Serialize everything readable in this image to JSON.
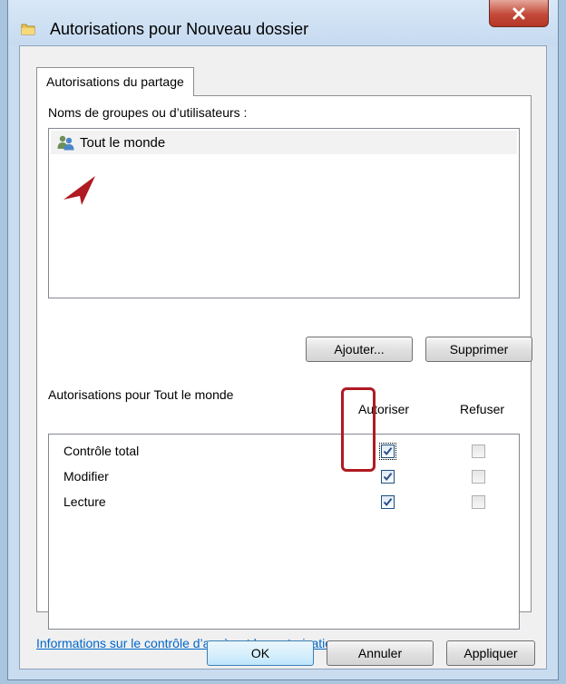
{
  "window": {
    "title": "Autorisations pour Nouveau dossier",
    "close_label": "X"
  },
  "tab": {
    "label": "Autorisations du partage"
  },
  "groups": {
    "label": "Noms de groupes ou d’utilisateurs :",
    "items": [
      {
        "label": "Tout le monde",
        "icon": "users-icon",
        "selected": true
      }
    ]
  },
  "group_buttons": {
    "add_label": "Ajouter...",
    "remove_label": "Supprimer"
  },
  "permissions": {
    "label": "Autorisations pour Tout le monde",
    "allow_header": "Autoriser",
    "deny_header": "Refuser",
    "rows": [
      {
        "name": "Contrôle total",
        "allow": true,
        "deny": false
      },
      {
        "name": "Modifier",
        "allow": true,
        "deny": false
      },
      {
        "name": "Lecture",
        "allow": true,
        "deny": false
      }
    ]
  },
  "help_link": "Informations sur le contrôle d’accès et les autorisations",
  "buttons": {
    "ok": "OK",
    "cancel": "Annuler",
    "apply": "Appliquer"
  },
  "colors": {
    "annotation": "#b01a22",
    "accent": "#3399ff"
  }
}
